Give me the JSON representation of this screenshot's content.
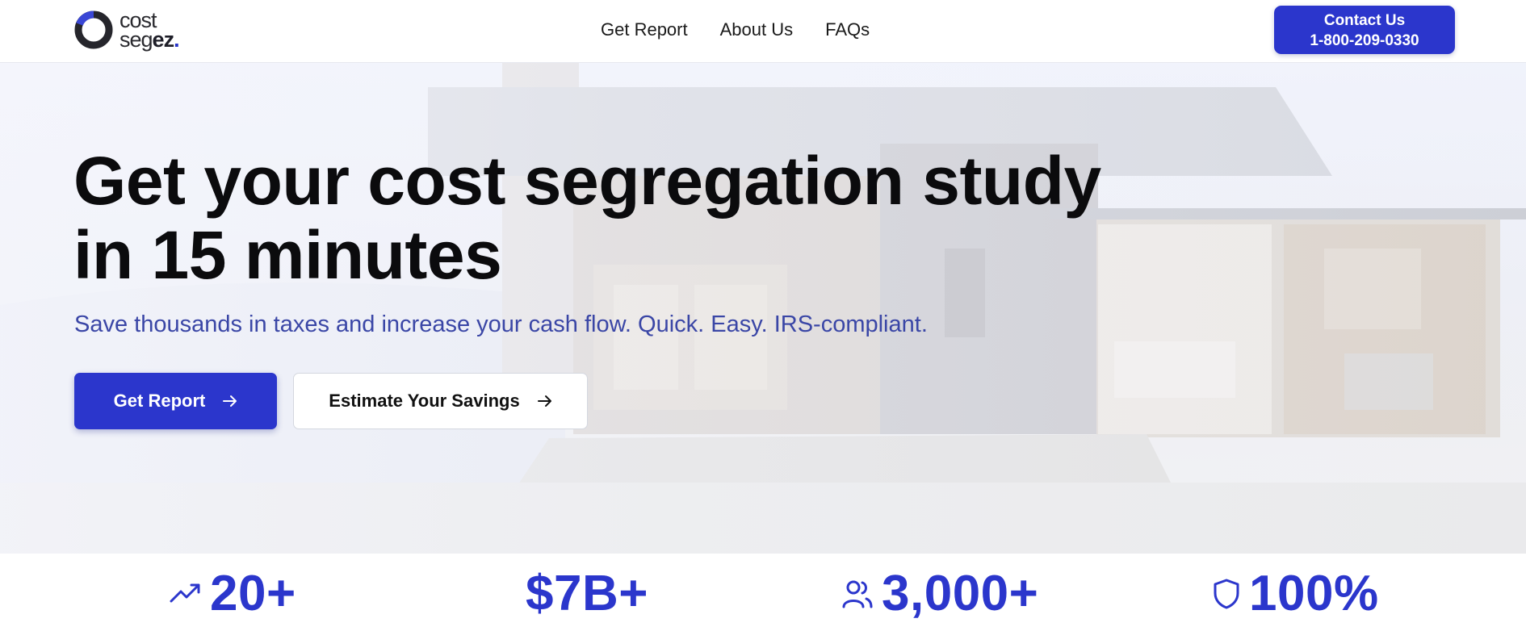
{
  "header": {
    "logo": {
      "line1": "cost",
      "line2_a": "seg",
      "line2_b": "ez",
      "line2_c": "."
    },
    "nav": [
      "Get Report",
      "About Us",
      "FAQs"
    ],
    "contact": {
      "line1": "Contact Us",
      "line2": "1-800-209-0330"
    }
  },
  "hero": {
    "headline_line1": "Get your cost segregation study",
    "headline_line2": "in 15 minutes",
    "subhead": "Save thousands in taxes and increase your cash flow. Quick. Easy. IRS-compliant.",
    "primary_button": "Get Report",
    "secondary_button": "Estimate Your Savings"
  },
  "stats": [
    {
      "icon": "trending-up-icon",
      "value": "20+"
    },
    {
      "icon": "dollar-icon",
      "value": "$7B+"
    },
    {
      "icon": "users-icon",
      "value": "3,000+"
    },
    {
      "icon": "shield-icon",
      "value": "100%"
    }
  ],
  "colors": {
    "brand": "#2b36cc",
    "subhead": "#3a46a6"
  }
}
